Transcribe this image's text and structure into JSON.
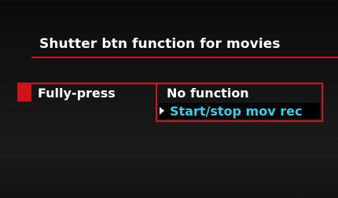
{
  "menu": {
    "title": "Shutter btn function for movies",
    "setting": {
      "label": "Fully-press"
    },
    "options": [
      {
        "label": "No function",
        "selected": false
      },
      {
        "label": "Start/stop mov rec",
        "selected": true
      }
    ],
    "colors": {
      "accent": "#d11218",
      "highlight_text": "#2fd0ee",
      "text": "#ffffff",
      "background": "#111111"
    },
    "icons": {
      "cursor": "cursor-triangle-icon"
    }
  }
}
